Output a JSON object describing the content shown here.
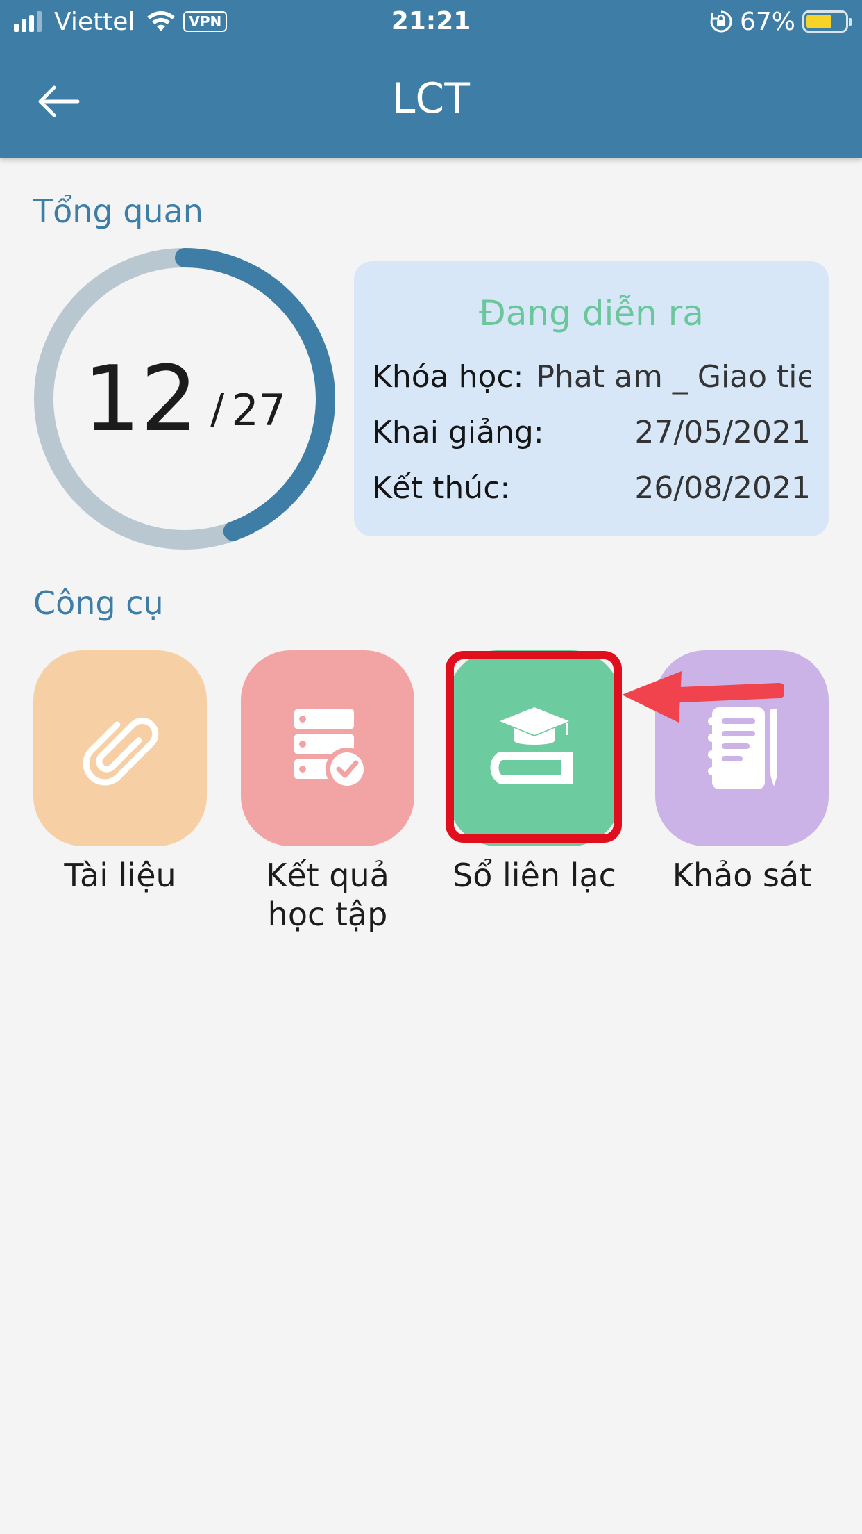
{
  "status_bar": {
    "carrier": "Viettel",
    "vpn": "VPN",
    "time": "21:21",
    "battery_percent": "67%"
  },
  "header": {
    "title": "LCT",
    "back_icon": "arrow-left-icon"
  },
  "overview": {
    "section_title": "Tổng quan",
    "progress": {
      "current": "12",
      "separator": "/",
      "total": "27",
      "fraction": 0.444
    },
    "colors": {
      "ring_track": "#b9c8d0",
      "ring_fill": "#3e7ea6",
      "status_text": "#6cc69c",
      "card_bg": "#d7e7f7"
    },
    "card": {
      "status": "Đang diễn ra",
      "course_label": "Khóa học:",
      "course_value": "Phat am _ Giao tie",
      "start_label": "Khai giảng:",
      "start_value": "27/05/2021",
      "end_label": "Kết thúc:",
      "end_value": "26/08/2021"
    }
  },
  "tools": {
    "section_title": "Công cụ",
    "items": [
      {
        "label": "Tài liệu",
        "icon": "paperclip-icon",
        "color": "#f7cfa4"
      },
      {
        "label_line1": "Kết quả",
        "label_line2": "học tập",
        "icon": "results-check-icon",
        "color": "#f2a3a3"
      },
      {
        "label": "Sổ liên lạc",
        "icon": "graduation-book-icon",
        "color": "#6ccb9f"
      },
      {
        "label": "Khảo sát",
        "icon": "notebook-icon",
        "color": "#cbb3e8"
      }
    ],
    "highlight_color": "#e10f1e",
    "arrow_color": "#f0434d"
  }
}
